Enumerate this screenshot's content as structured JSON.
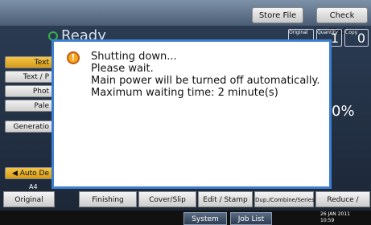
{
  "top": {
    "store_file": "Store File",
    "check_modes": "Check Modes"
  },
  "status": {
    "ready": "Ready"
  },
  "counters": {
    "original_label": "Original",
    "quantity_label": "Quantity",
    "quantity_value": "1",
    "copy_label": "Copy",
    "copy_value": "0"
  },
  "left_panel": {
    "items": [
      "Text",
      "Text / P",
      "Phot",
      "Pale",
      "Generatio"
    ],
    "auto_label": "Auto De",
    "paper_label": "A4"
  },
  "right_panel": {
    "percent": "0%"
  },
  "bottom_tabs": {
    "original_setting": "Original Setting",
    "finishing": "Finishing",
    "cover_slip": "Cover/Slip Sheet",
    "edit_stamp": "Edit / Stamp",
    "dup_combine": "Dup./Combine/Series",
    "reduce_enlarge": "Reduce / Enlarge"
  },
  "status_bar": {
    "system_status": "System Status",
    "job_list": "Job List",
    "date": "26 JAN 2011",
    "time": "10:59"
  },
  "dialog": {
    "lines": [
      "Shutting down...",
      "Please wait.",
      "Main power will be turned off automatically.",
      "Maximum waiting time: 2 minute(s)"
    ]
  }
}
